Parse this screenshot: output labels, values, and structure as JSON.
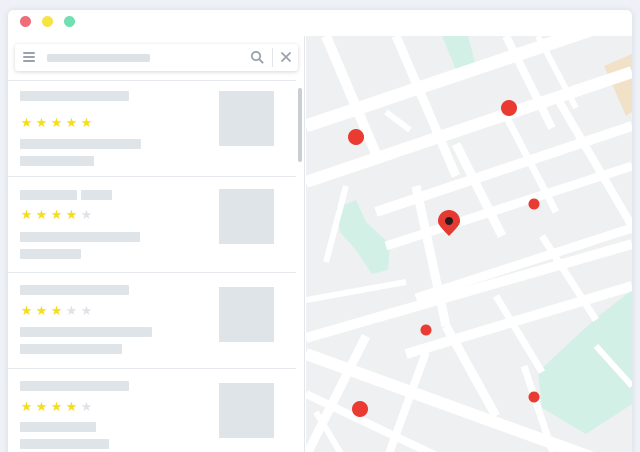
{
  "window": {
    "controls": [
      "close",
      "minimize",
      "maximize"
    ],
    "colors": {
      "close": "#ef6d78",
      "minimize": "#f6e443",
      "maximize": "#6ee0b1"
    }
  },
  "search": {
    "value": "",
    "icons": [
      "hamburger-menu-icon",
      "search-icon",
      "close-icon"
    ]
  },
  "results": [
    {
      "rating": 5,
      "max_rating": 5
    },
    {
      "rating": 4,
      "max_rating": 5
    },
    {
      "rating": 3,
      "max_rating": 5
    },
    {
      "rating": 4,
      "max_rating": 5
    }
  ],
  "collapse_handle": {
    "label": "◀"
  },
  "map": {
    "colors": {
      "land": "#eef0f1",
      "road": "#ffffff",
      "park": "#d3f0e6",
      "building": "#f1e1c6",
      "marker": "#ea3b33",
      "selected_marker": "#e53a31"
    },
    "marker_count": 7,
    "selected_marker_icon": "map-pin-icon"
  },
  "colors": {
    "star_on": "#f6dd18",
    "star_off": "#dfe3e8",
    "placeholder": "#dfe4e8"
  }
}
